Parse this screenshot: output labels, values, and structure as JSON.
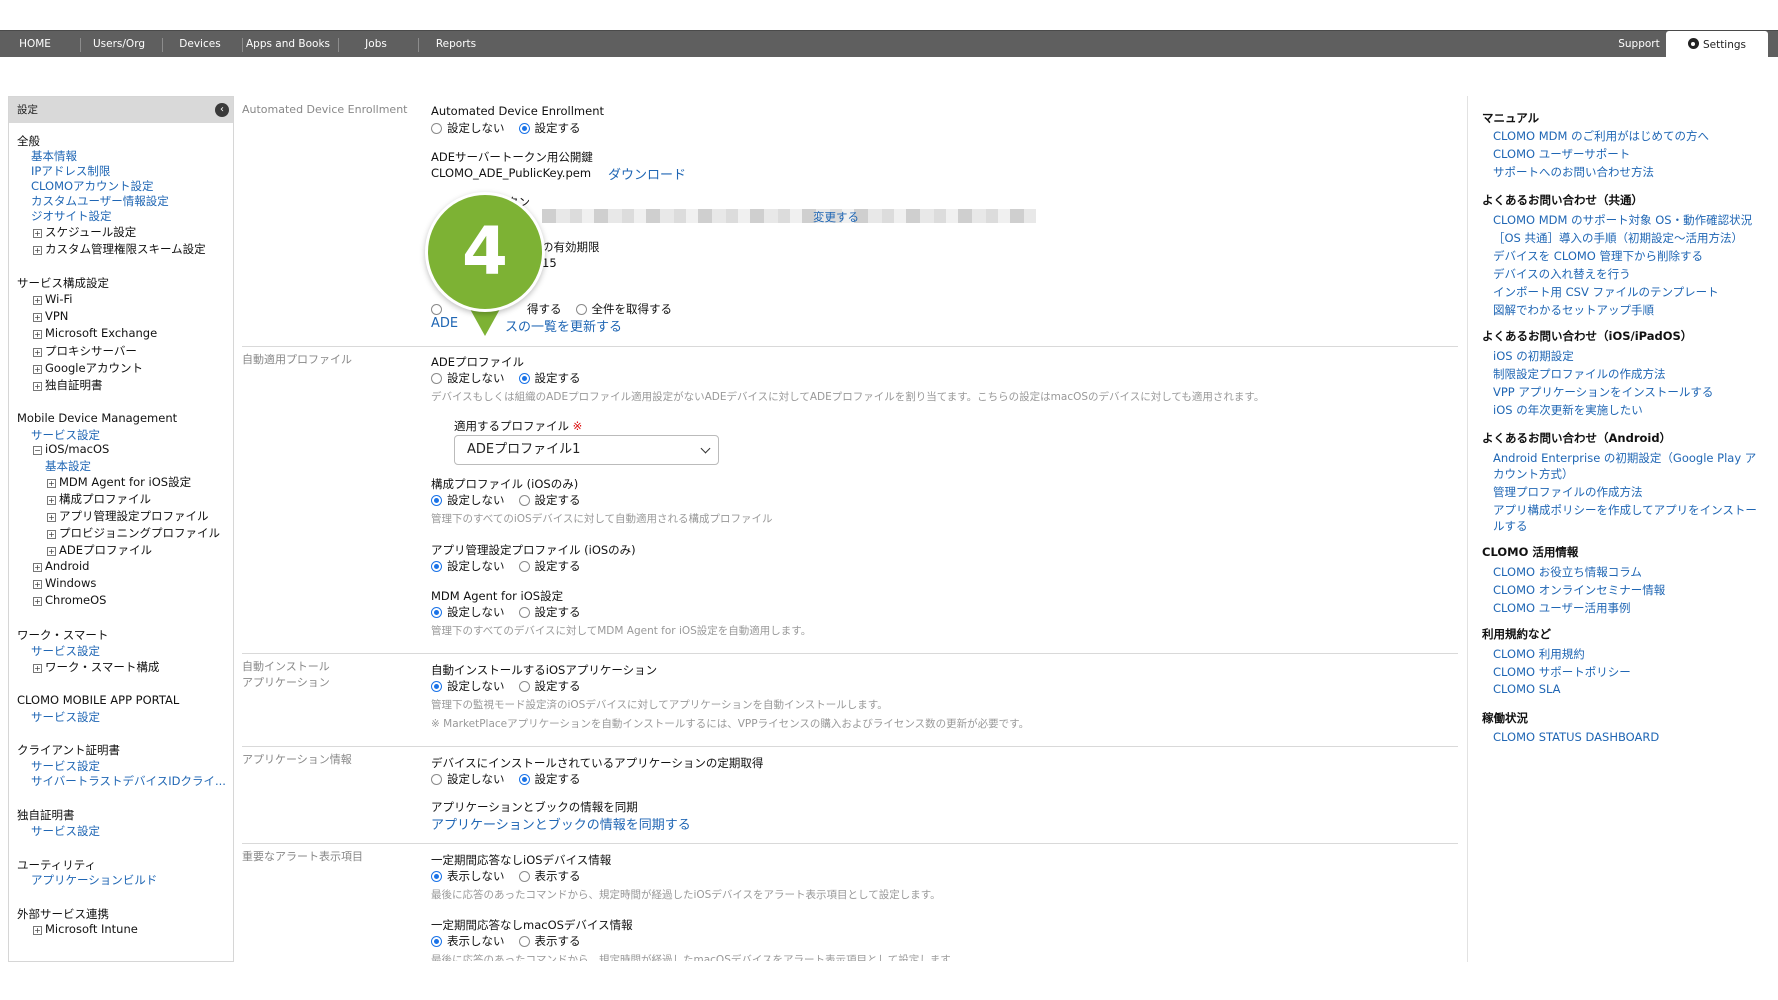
{
  "nav": {
    "home": "HOME",
    "users_org": "Users/Org",
    "devices": "Devices",
    "apps_books": "Apps and Books",
    "jobs": "Jobs",
    "reports": "Reports",
    "support": "Support",
    "settings": "Settings"
  },
  "sidebar": {
    "header": "設定",
    "general": {
      "title": "全般",
      "links": [
        "基本情報",
        "IPアドレス制限",
        "CLOMOアカウント設定",
        "カスタムユーザー情報設定",
        "ジオサイト設定"
      ],
      "trees": [
        "スケジュール設定",
        "カスタム管理権限スキーム設定"
      ]
    },
    "service_config": {
      "title": "サービス構成設定",
      "trees": [
        "Wi-Fi",
        "VPN",
        "Microsoft Exchange",
        "プロキシサーバー",
        "Googleアカウント",
        "独自証明書"
      ]
    },
    "mdm": {
      "title": "Mobile Device Management",
      "service_settings": "サービス設定",
      "ios_macos": "iOS/macOS",
      "basic_settings": "基本設定",
      "ios_children": [
        "MDM Agent for iOS設定",
        "構成プロファイル",
        "アプリ管理設定プロファイル",
        "プロビジョニングプロファイル",
        "ADEプロファイル"
      ],
      "android": "Android",
      "windows": "Windows",
      "chromeos": "ChromeOS"
    },
    "work_smart": {
      "title": "ワーク・スマート",
      "service_settings": "サービス設定",
      "config": "ワーク・スマート構成"
    },
    "app_portal": {
      "title": "CLOMO MOBILE APP PORTAL",
      "service_settings": "サービス設定"
    },
    "client_cert": {
      "title": "クライアント証明書",
      "service_settings": "サービス設定",
      "cybertrust": "サイバートラストデバイスIDクライ..."
    },
    "own_cert": {
      "title": "独自証明書",
      "service_settings": "サービス設定"
    },
    "utility": {
      "title": "ユーティリティ",
      "app_build": "アプリケーションビルド"
    },
    "external": {
      "title": "外部サービス連携",
      "intune": "Microsoft Intune"
    }
  },
  "main": {
    "ade_section_label": "Automated Device Enrollment",
    "ade_title": "Automated Device Enrollment",
    "opt_no": "設定しない",
    "opt_yes": "設定する",
    "pubkey_title": "ADEサーバートークン用公開鍵",
    "pubkey_file": "CLOMO_ADE_PublicKey.pem",
    "download": "ダウンロード",
    "token_title_partial": "クン",
    "change": "変更する",
    "expiry_partial": "の有効期限",
    "expiry_value_partial": "15",
    "fetch_diff_partial": "得する",
    "fetch_all": "全件を取得する",
    "update_list_prefix": "ADE",
    "update_list_suffix": "スの一覧を更新する",
    "auto_profile_label": "自動適用プロファイル",
    "ade_profile_title": "ADEプロファイル",
    "ade_profile_desc": "デバイスもしくは組織のADEプロファイル適用設定がないADEデバイスに対してADEプロファイルを割り当てます。こちらの設定はmacOSのデバイスに対しても適用されます。",
    "apply_profile_label": "適用するプロファイル",
    "required_mark": "※",
    "apply_profile_value": "ADEプロファイル1",
    "config_profile_title": "構成プロファイル (iOSのみ)",
    "config_profile_desc": "管理下のすべてのiOSデバイスに対して自動適用される構成プロファイル",
    "app_mgmt_title": "アプリ管理設定プロファイル (iOSのみ)",
    "mdm_agent_title": "MDM Agent for iOS設定",
    "mdm_agent_desc": "管理下のすべてのデバイスに対してMDM Agent for iOS設定を自動適用します。",
    "auto_install_label_1": "自動インストール",
    "auto_install_label_2": "アプリケーション",
    "auto_install_title": "自動インストールするiOSアプリケーション",
    "auto_install_desc": "管理下の監視モード設定済のiOSデバイスに対してアプリケーションを自動インストールします。",
    "auto_install_note": "※ MarketPlaceアプリケーションを自動インストールするには、VPPライセンスの購入およびライセンス数の更新が必要です。",
    "app_info_label": "アプリケーション情報",
    "app_info_title": "デバイスにインストールされているアプリケーションの定期取得",
    "sync_title": "アプリケーションとブックの情報を同期",
    "sync_link": "アプリケーションとブックの情報を同期する",
    "alert_label": "重要なアラート表示項目",
    "alert_ios_title": "一定期間応答なしiOSデバイス情報",
    "opt_hide": "表示しない",
    "opt_show": "表示する",
    "alert_ios_desc": "最後に応答のあったコマンドから、規定時間が経過したiOSデバイスをアラート表示項目として設定します。",
    "alert_mac_title": "一定期間応答なしmacOSデバイス情報",
    "alert_mac_desc_partial": "最後に応答のあったコマンドから、規定時間が経過したmacOSデバイスをアラート表示項目として設定します。"
  },
  "callout": {
    "number": "4",
    "color": "#7db234"
  },
  "right": {
    "manual": {
      "title": "マニュアル",
      "links": [
        "CLOMO MDM のご利用がはじめての方へ",
        "CLOMO ユーザーサポート",
        "サポートへのお問い合わせ方法"
      ]
    },
    "faq_common": {
      "title": "よくあるお問い合わせ（共通）",
      "links": [
        "CLOMO MDM のサポート対象 OS・動作確認状況",
        "［OS 共通］導入の手順（初期設定〜活用方法）",
        "デバイスを CLOMO 管理下から削除する",
        "デバイスの入れ替えを行う",
        "インポート用 CSV ファイルのテンプレート",
        "図解でわかるセットアップ手順"
      ]
    },
    "faq_ios": {
      "title": "よくあるお問い合わせ（iOS/iPadOS）",
      "links": [
        "iOS の初期設定",
        "制限設定プロファイルの作成方法",
        "VPP アプリケーションをインストールする",
        "iOS の年次更新を実施したい"
      ]
    },
    "faq_android": {
      "title": "よくあるお問い合わせ（Android）",
      "links": [
        "Android Enterprise の初期設定（Google Play ア",
        "カウント方式）",
        "管理プロファイルの作成方法",
        "アプリ構成ポリシーを作成してアプリをインストー",
        "ルする"
      ]
    },
    "usage": {
      "title": "CLOMO 活用情報",
      "links": [
        "CLOMO お役立ち情報コラム",
        "CLOMO オンラインセミナー情報",
        "CLOMO ユーザー活用事例"
      ]
    },
    "terms": {
      "title": "利用規約など",
      "links": [
        "CLOMO 利用規約",
        "CLOMO サポートポリシー",
        "CLOMO SLA"
      ]
    },
    "status": {
      "title": "稼働状況",
      "links": [
        "CLOMO STATUS DASHBOARD"
      ]
    }
  }
}
